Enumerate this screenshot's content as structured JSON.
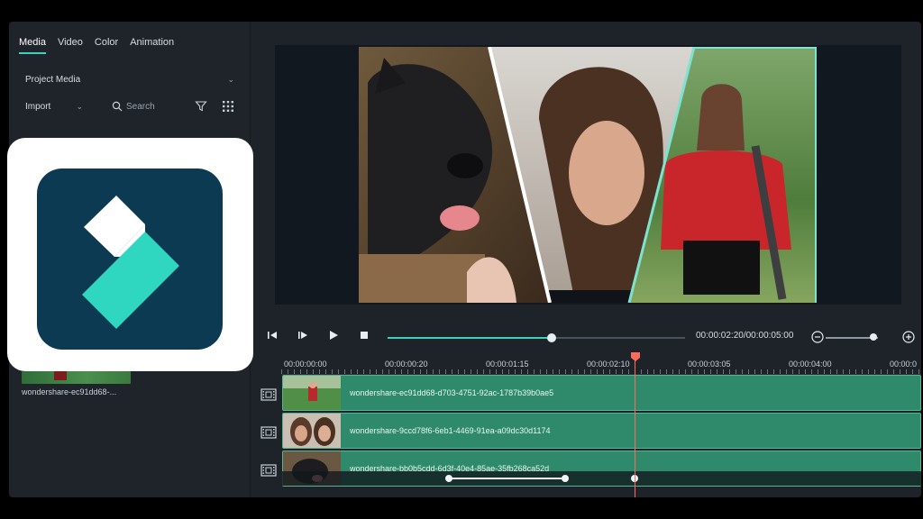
{
  "tabs": [
    {
      "label": "Media",
      "active": true
    },
    {
      "label": "Video",
      "active": false
    },
    {
      "label": "Color",
      "active": false
    },
    {
      "label": "Animation",
      "active": false
    }
  ],
  "media_panel": {
    "project_media_label": "Project Media",
    "import_label": "Import",
    "search_placeholder": "Search",
    "file_label": "wondershare-ec91dd68-..."
  },
  "playback": {
    "timecode": "00:00:02:20/00:00:05:00",
    "progress": 0.55,
    "zoom_level": 0.9
  },
  "ruler": {
    "labels": [
      "00:00:00:00",
      "00:00:00:20",
      "00:00:01:15",
      "00:00:02:10",
      "00:00:03:05",
      "00:00:04:00",
      "00:00:0"
    ]
  },
  "tracks": [
    {
      "clip_name": "wondershare-ec91dd68-d703-4751-92ac-1787b39b0ae5"
    },
    {
      "clip_name": "wondershare-9ccd78f6-6eb1-4469-91ea-a09dc30d1174"
    },
    {
      "clip_name": "wondershare-bb0b5cdd-6d3f-40e4-85ae-35fb268ca52d"
    }
  ],
  "icons": {
    "filter": "filter-icon",
    "grid": "grid-icon",
    "search": "search-icon",
    "track": "film-icon"
  },
  "colors": {
    "accent": "#39d3bb",
    "clip_green": "#2f8a6b",
    "playhead": "#ff6b5b",
    "logo_navy": "#0b3a52"
  }
}
